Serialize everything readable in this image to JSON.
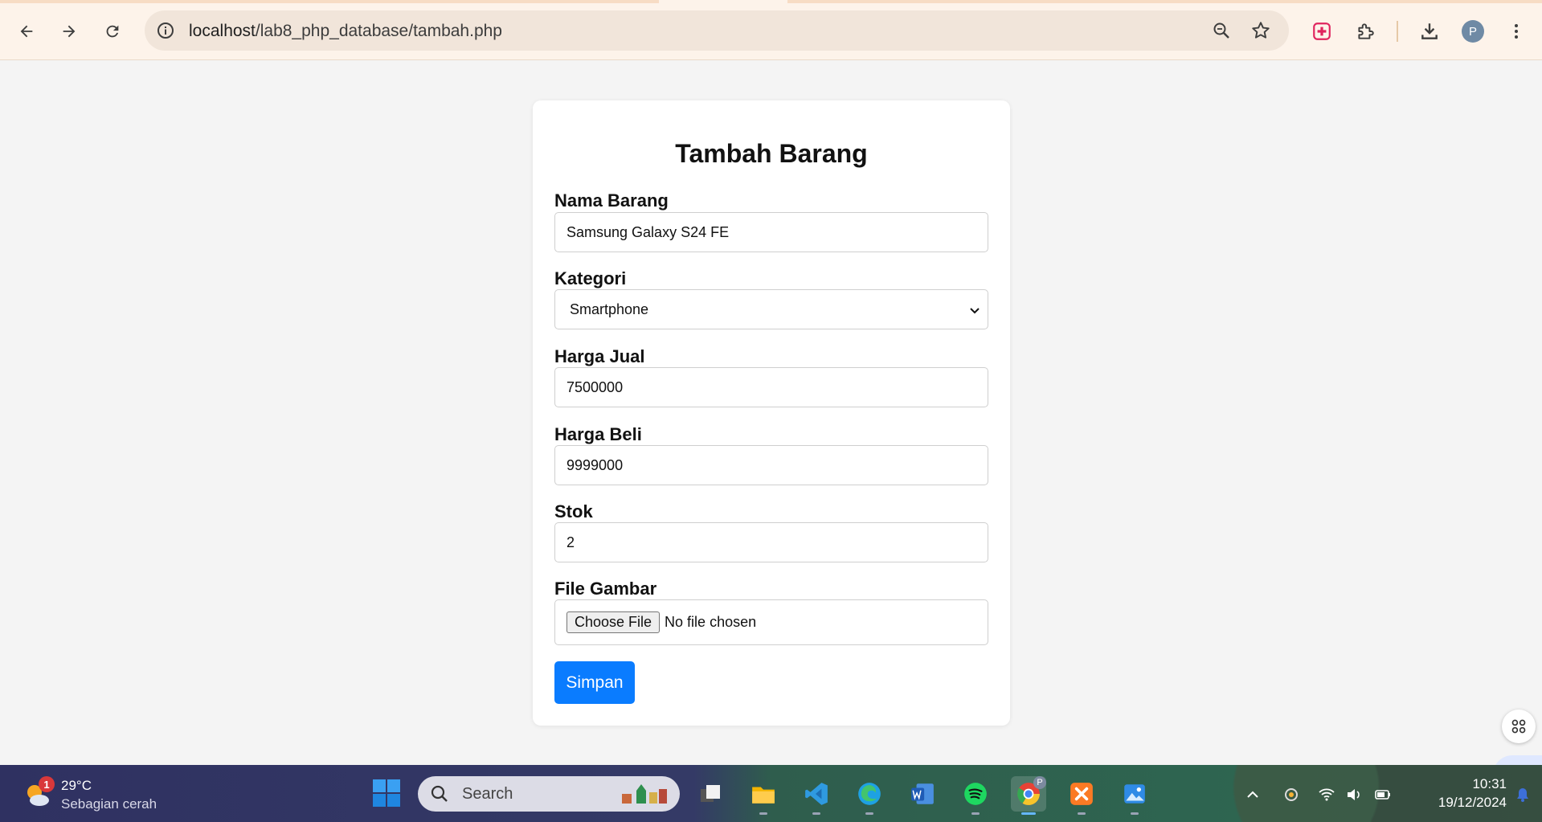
{
  "browser": {
    "url_host": "localhost",
    "url_path": "/lab8_php_database/tambah.php",
    "avatar_letter": "P"
  },
  "form": {
    "title": "Tambah Barang",
    "nama_label": "Nama Barang",
    "nama_value": "Samsung Galaxy S24 FE",
    "kategori_label": "Kategori",
    "kategori_value": "Smartphone",
    "harga_jual_label": "Harga Jual",
    "harga_jual_value": "7500000",
    "harga_beli_label": "Harga Beli",
    "harga_beli_value": "9999000",
    "stok_label": "Stok",
    "stok_value": "2",
    "file_label": "File Gambar",
    "file_button": "Choose File",
    "file_status": "No file chosen",
    "submit_label": "Simpan"
  },
  "taskbar": {
    "weather_badge": "1",
    "temperature": "29°C",
    "condition": "Sebagian cerah",
    "search_label": "Search",
    "time": "10:31",
    "date": "19/12/2024",
    "chrome_badge": "P"
  },
  "colors": {
    "accent": "#0a7cff",
    "page_bg": "#f4f4f4"
  }
}
